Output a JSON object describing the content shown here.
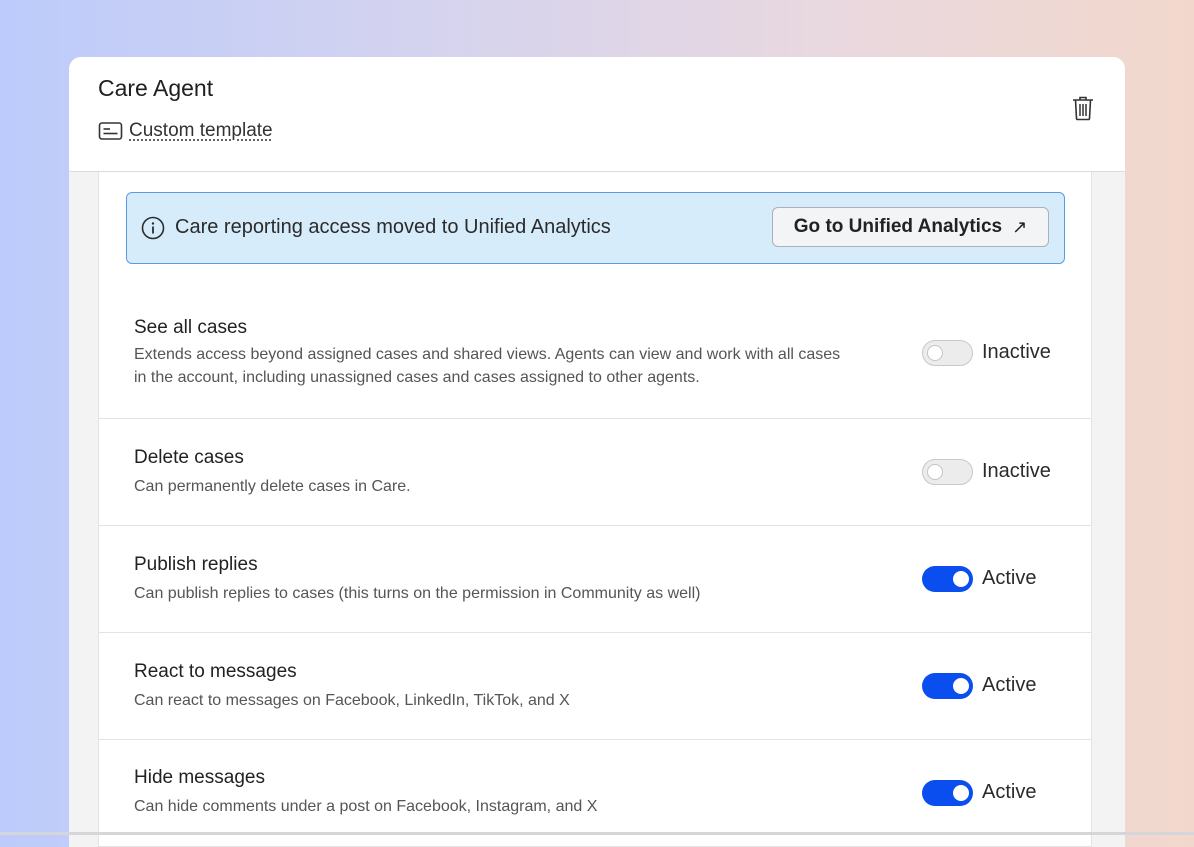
{
  "header": {
    "title": "Care Agent",
    "template_label": "Custom template",
    "template_icon": "template-card-icon",
    "delete_icon": "trash-icon"
  },
  "banner": {
    "icon": "info-circle-icon",
    "message": "Care reporting access moved to Unified Analytics",
    "button_label": "Go to Unified Analytics",
    "button_icon": "external-arrow-icon",
    "button_arrow": "↗"
  },
  "colors": {
    "accent": "#0a4ef0",
    "banner_bg": "#d7ecfb",
    "banner_border": "#5a9ddf"
  },
  "permissions": [
    {
      "title": "See all cases",
      "description": "Extends access beyond assigned cases and shared views. Agents can view and work with all cases in the account, including unassigned cases and cases assigned to other agents.",
      "active": false,
      "status": "Inactive"
    },
    {
      "title": "Delete cases",
      "description": "Can permanently delete cases in Care.",
      "active": false,
      "status": "Inactive"
    },
    {
      "title": "Publish replies",
      "description": "Can publish replies to cases (this turns on the permission in Community as well)",
      "active": true,
      "status": "Active"
    },
    {
      "title": "React to messages",
      "description": "Can react to messages on Facebook, LinkedIn, TikTok, and X",
      "active": true,
      "status": "Active"
    },
    {
      "title": "Hide messages",
      "description": "Can hide comments under a post on Facebook, Instagram, and X",
      "active": true,
      "status": "Active"
    }
  ]
}
